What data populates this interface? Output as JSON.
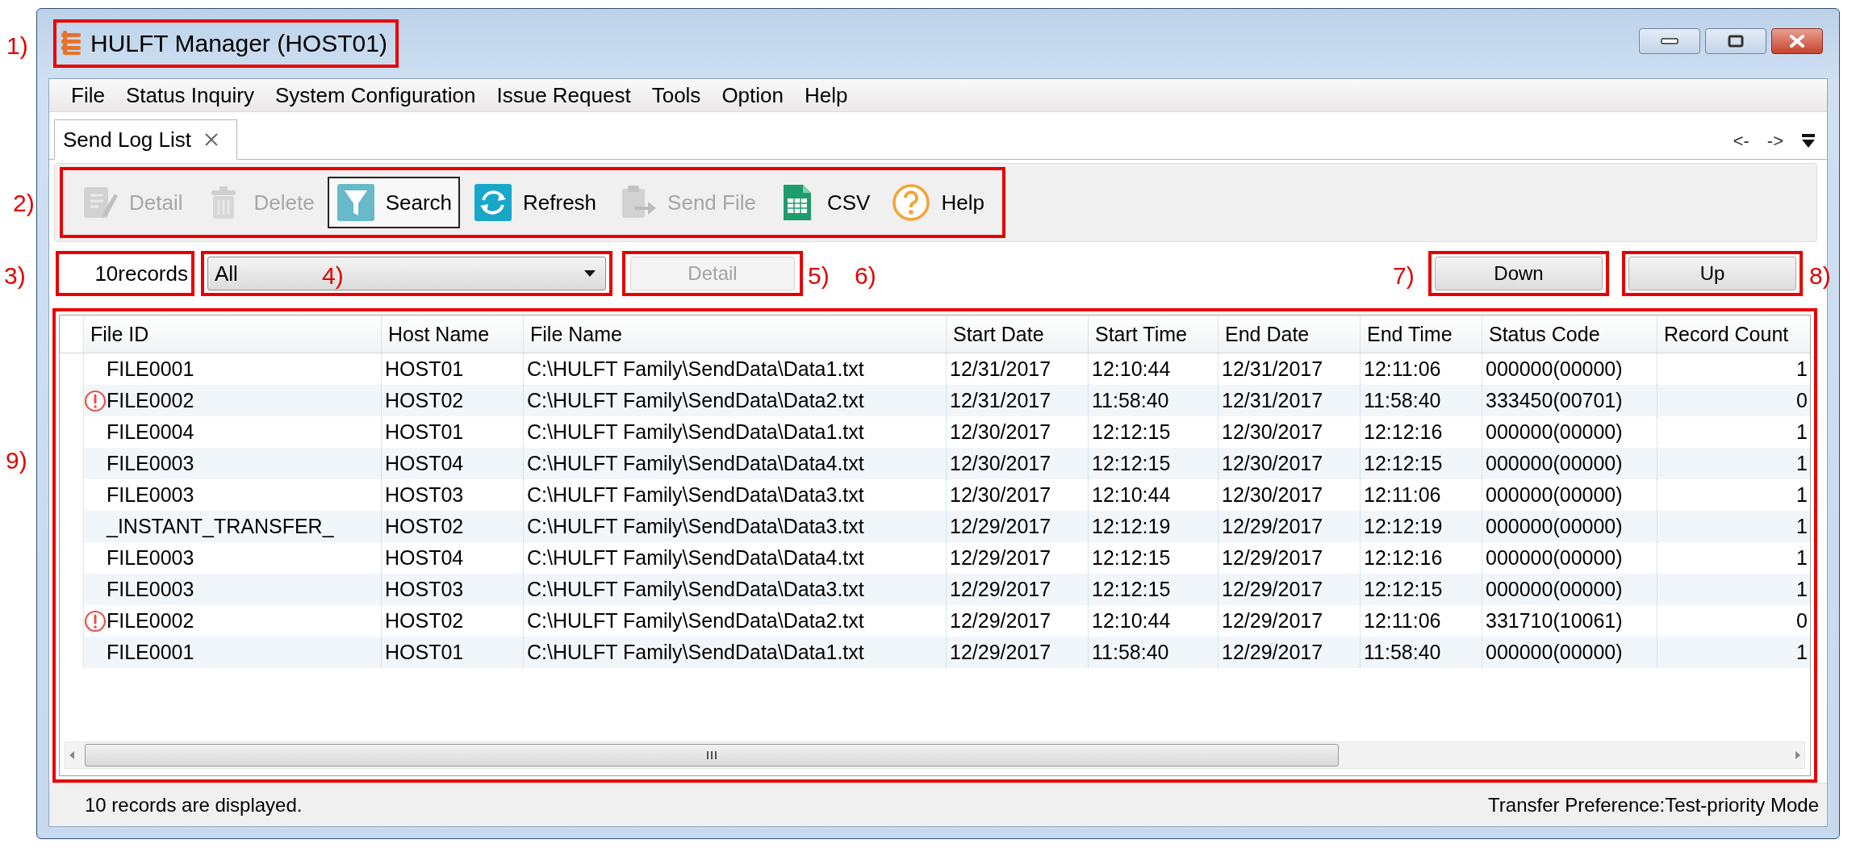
{
  "window": {
    "title": "HULFT Manager (HOST01)",
    "callout": "1)"
  },
  "menu": [
    {
      "label": "File"
    },
    {
      "label": "Status Inquiry"
    },
    {
      "label": "System Configuration"
    },
    {
      "label": "Issue Request"
    },
    {
      "label": "Tools"
    },
    {
      "label": "Option"
    },
    {
      "label": "Help"
    }
  ],
  "tabs": [
    {
      "label": "Send Log List",
      "selected": true
    }
  ],
  "tab_nav": [
    "<-",
    "->"
  ],
  "toolbar": {
    "callout": "2)",
    "buttons": [
      {
        "label": "Detail",
        "kind": "edit",
        "disabled": true,
        "pressed": false
      },
      {
        "label": "Delete",
        "kind": "trash",
        "disabled": true,
        "pressed": false
      },
      {
        "label": "Search",
        "kind": "funnel",
        "disabled": false,
        "pressed": true
      },
      {
        "label": "Refresh",
        "kind": "refresh",
        "disabled": false,
        "pressed": false
      },
      {
        "label": "Send File",
        "kind": "send",
        "disabled": true,
        "pressed": false
      },
      {
        "label": "CSV",
        "kind": "csv",
        "disabled": false,
        "pressed": false
      },
      {
        "label": "Help",
        "kind": "help",
        "disabled": false,
        "pressed": false
      }
    ]
  },
  "filter": {
    "record_count": {
      "text": "10records",
      "callout": "3)"
    },
    "dropdown": {
      "value": "All",
      "callout": "4)"
    },
    "detail_button": {
      "label": "Detail",
      "disabled": true,
      "callout": "5)"
    },
    "extra_callout": "6)",
    "down_button": {
      "label": "Down",
      "callout": "7)"
    },
    "up_button": {
      "label": "Up",
      "callout": "8)"
    }
  },
  "table": {
    "callout": "9)",
    "columns": [
      {
        "label": "File ID",
        "kind": "text"
      },
      {
        "label": "Host Name",
        "kind": "text"
      },
      {
        "label": "File Name",
        "kind": "text"
      },
      {
        "label": "Start Date",
        "kind": "text"
      },
      {
        "label": "Start Time",
        "kind": "text"
      },
      {
        "label": "End Date",
        "kind": "text"
      },
      {
        "label": "End Time",
        "kind": "text"
      },
      {
        "label": "Status Code",
        "kind": "text"
      },
      {
        "label": "Record Count",
        "kind": "number"
      }
    ],
    "rows": [
      {
        "error": false,
        "cells": [
          "FILE0001",
          "HOST01",
          "C:\\HULFT Family\\SendData\\Data1.txt",
          "12/31/2017",
          "12:10:44",
          "12/31/2017",
          "12:11:06",
          "000000(00000)",
          "1"
        ]
      },
      {
        "error": true,
        "cells": [
          "FILE0002",
          "HOST02",
          "C:\\HULFT Family\\SendData\\Data2.txt",
          "12/31/2017",
          "11:58:40",
          "12/31/2017",
          "11:58:40",
          "333450(00701)",
          "0"
        ]
      },
      {
        "error": false,
        "cells": [
          "FILE0004",
          "HOST01",
          "C:\\HULFT Family\\SendData\\Data1.txt",
          "12/30/2017",
          "12:12:15",
          "12/30/2017",
          "12:12:16",
          "000000(00000)",
          "1"
        ]
      },
      {
        "error": false,
        "cells": [
          "FILE0003",
          "HOST04",
          "C:\\HULFT Family\\SendData\\Data4.txt",
          "12/30/2017",
          "12:12:15",
          "12/30/2017",
          "12:12:15",
          "000000(00000)",
          "1"
        ]
      },
      {
        "error": false,
        "cells": [
          "FILE0003",
          "HOST03",
          "C:\\HULFT Family\\SendData\\Data3.txt",
          "12/30/2017",
          "12:10:44",
          "12/30/2017",
          "12:11:06",
          "000000(00000)",
          "1"
        ]
      },
      {
        "error": false,
        "cells": [
          "_INSTANT_TRANSFER_",
          "HOST02",
          "C:\\HULFT Family\\SendData\\Data3.txt",
          "12/29/2017",
          "12:12:19",
          "12/29/2017",
          "12:12:19",
          "000000(00000)",
          "1"
        ]
      },
      {
        "error": false,
        "cells": [
          "FILE0003",
          "HOST04",
          "C:\\HULFT Family\\SendData\\Data4.txt",
          "12/29/2017",
          "12:12:15",
          "12/29/2017",
          "12:12:16",
          "000000(00000)",
          "1"
        ]
      },
      {
        "error": false,
        "cells": [
          "FILE0003",
          "HOST03",
          "C:\\HULFT Family\\SendData\\Data3.txt",
          "12/29/2017",
          "12:12:15",
          "12/29/2017",
          "12:12:15",
          "000000(00000)",
          "1"
        ]
      },
      {
        "error": true,
        "cells": [
          "FILE0002",
          "HOST02",
          "C:\\HULFT Family\\SendData\\Data2.txt",
          "12/29/2017",
          "12:10:44",
          "12/29/2017",
          "12:11:06",
          "331710(10061)",
          "0"
        ]
      },
      {
        "error": false,
        "cells": [
          "FILE0001",
          "HOST01",
          "C:\\HULFT Family\\SendData\\Data1.txt",
          "12/29/2017",
          "11:58:40",
          "12/29/2017",
          "11:58:40",
          "000000(00000)",
          "1"
        ]
      }
    ]
  },
  "status_bar": {
    "left": "10 records are displayed.",
    "right": "Transfer Preference:Test-priority Mode"
  }
}
